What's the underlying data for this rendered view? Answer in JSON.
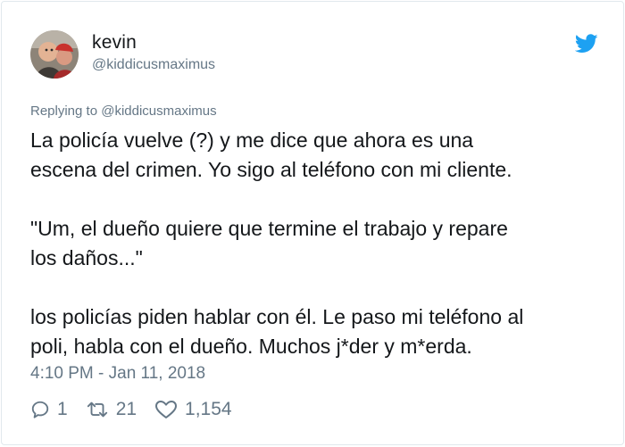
{
  "user": {
    "display_name": "kevin",
    "handle": "@kiddicusmaximus",
    "avatar_icon": "user-avatar-photo"
  },
  "brand_icon": "twitter-bird-icon",
  "colors": {
    "brand": "#1da1f2",
    "muted": "#657786",
    "text": "#14171a",
    "border": "#e1e8ed"
  },
  "reply": {
    "prefix": "Replying to",
    "mention": "@kiddicusmaximus"
  },
  "tweet": {
    "paragraphs": [
      "La policía vuelve (?) y me dice que ahora es una\nescena del crimen. Yo sigo al teléfono con mi cliente.",
      "\"Um, el dueño quiere que termine el trabajo y repare\nlos daños...\"",
      "los policías piden hablar con él. Le paso mi teléfono al\npoli, habla con el dueño. Muchos j*der y m*erda."
    ],
    "timestamp": "4:10 PM - Jan 11, 2018"
  },
  "actions": {
    "replies": "1",
    "retweets": "21",
    "likes": "1,154"
  }
}
